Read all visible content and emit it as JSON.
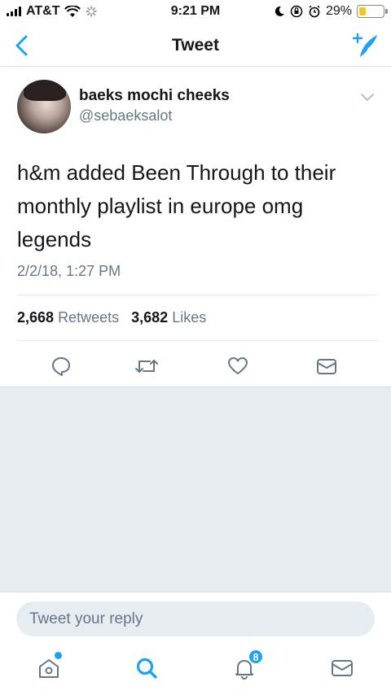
{
  "status_bar": {
    "carrier": "AT&T",
    "time": "9:21 PM",
    "battery_percent": "29%",
    "battery_level": 0.29
  },
  "nav": {
    "title": "Tweet"
  },
  "tweet": {
    "display_name": "baeks mochi cheeks",
    "handle": "@sebaeksalot",
    "text": "h&m added Been Through to their monthly playlist in europe omg legends",
    "timestamp": "2/2/18, 1:27 PM",
    "retweets_count": "2,668",
    "retweets_label": "Retweets",
    "likes_count": "3,682",
    "likes_label": "Likes"
  },
  "reply": {
    "placeholder": "Tweet your reply"
  },
  "tab_bar": {
    "notifications_badge": "8"
  },
  "colors": {
    "accent": "#1da1f2",
    "text_primary": "#14171a",
    "text_secondary": "#657786",
    "background_gray": "#e6ecf0",
    "battery": "#f5c518"
  }
}
